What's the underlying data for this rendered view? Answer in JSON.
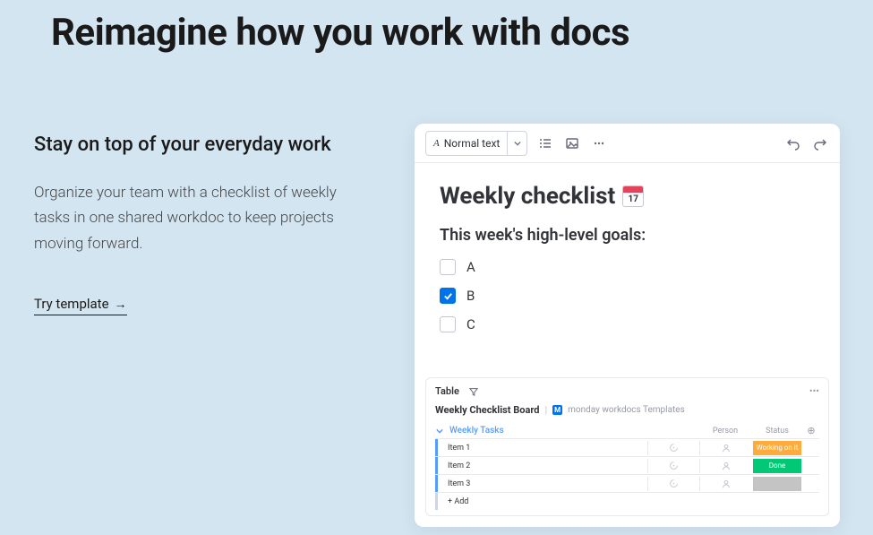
{
  "hero": {
    "title": "Reimagine how you work with docs",
    "subheading": "Stay on top of your everyday work",
    "description": "Organize your team with a checklist of weekly tasks in one shared workdoc to keep projects moving forward.",
    "cta": "Try template"
  },
  "toolbar": {
    "style_label": "Normal text"
  },
  "doc": {
    "title": "Weekly checklist",
    "calendar_day": "17",
    "section": "This week's high-level goals:",
    "items": [
      {
        "label": "A",
        "checked": false
      },
      {
        "label": "B",
        "checked": true
      },
      {
        "label": "C",
        "checked": false
      }
    ]
  },
  "board": {
    "tab": "Table",
    "title": "Weekly Checklist Board",
    "workspace": "monday workdocs Templates",
    "group": "Weekly Tasks",
    "columns": {
      "person": "Person",
      "status": "Status"
    },
    "rows": [
      {
        "label": "Item 1",
        "status": "Working on it",
        "status_color": "#fdab3d"
      },
      {
        "label": "Item 2",
        "status": "Done",
        "status_color": "#00c875"
      },
      {
        "label": "Item 3",
        "status": "",
        "status_color": "#c4c4c4"
      }
    ],
    "add": "+ Add"
  }
}
